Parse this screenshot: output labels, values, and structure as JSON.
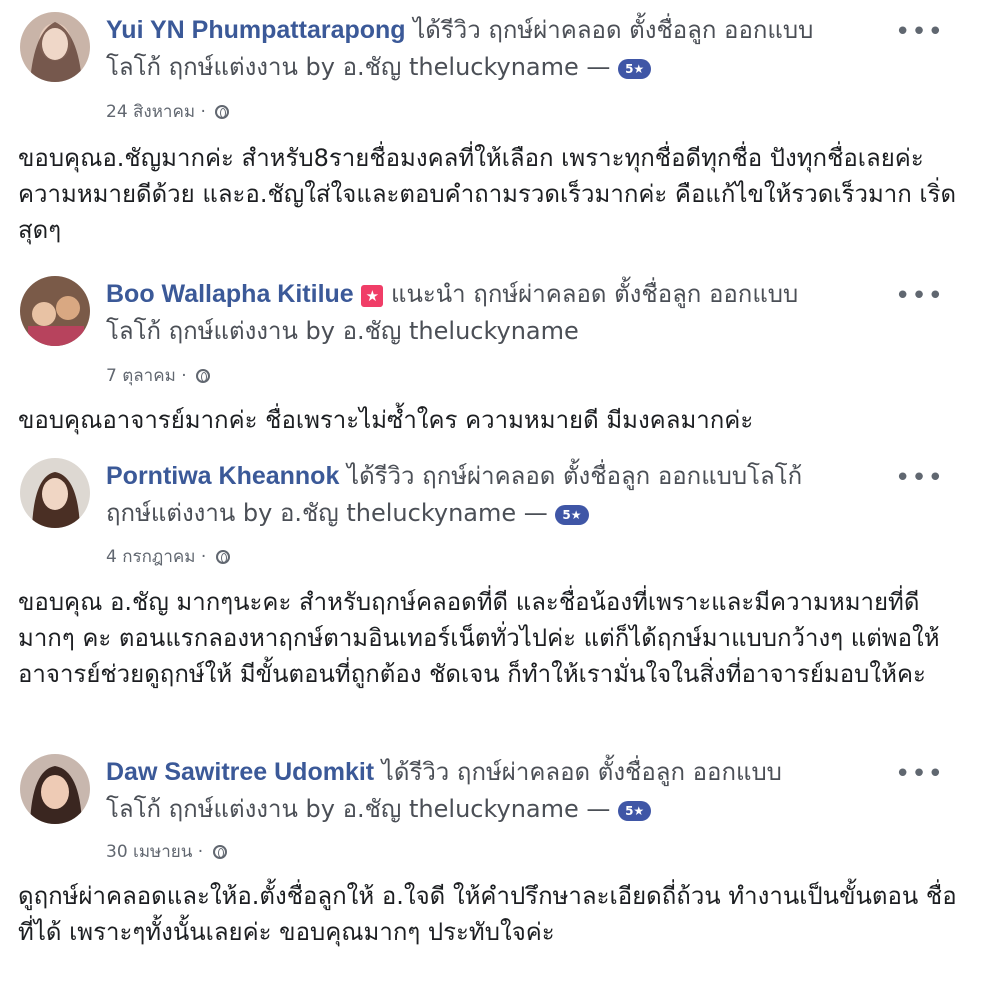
{
  "reviews": [
    {
      "name": "Yui YN Phumpattarapong",
      "verb": "ได้รีวิว",
      "page_line1": "ฤกษ์ผ่าคลอด ตั้งชื่อลูก ออกแบบ",
      "page_line2": "โลโก้ ฤกษ์แต่งงาน by อ.ชัญ theluckyname —",
      "rating": "5★",
      "date": "24 สิงหาคม ·",
      "body": "ขอบคุณอ.ชัญมากค่ะ สำหรับ8รายชื่อมงคลที่ให้เลือก เพราะทุกชื่อดีทุกชื่อ ปังทุกชื่อเลยค่ะ ความหมายดีด้วย และอ.ชัญใส่ใจและตอบคำถามรวดเร็วมากค่ะ คือแก้ไขให้รวดเร็วมาก เริ่ดสุดๆ",
      "more": "•••"
    },
    {
      "name": "Boo Wallapha Kitilue",
      "verb": "แนะนำ",
      "page_line1": "ฤกษ์ผ่าคลอด ตั้งชื่อลูก ออกแบบ",
      "page_line2": "โลโก้ ฤกษ์แต่งงาน by อ.ชัญ theluckyname",
      "rating": "",
      "date": "7 ตุลาคม ·",
      "body": "ขอบคุณอาจารย์มากค่ะ ชื่อเพราะไม่ซ้ำใคร ความหมายดี มีมงคลมากค่ะ",
      "more": "•••"
    },
    {
      "name": "Porntiwa Kheannok",
      "verb": "ได้รีวิว",
      "page_line1": "ฤกษ์ผ่าคลอด ตั้งชื่อลูก ออกแบบโลโก้",
      "page_line2": "ฤกษ์แต่งงาน by อ.ชัญ theluckyname —",
      "rating": "5★",
      "date": "4 กรกฎาคม ·",
      "body": "ขอบคุณ อ.ชัญ มากๆนะคะ สำหรับฤกษ์คลอดที่ดี และชื่อน้องที่เพราะและมีความหมายที่ดีมากๆ คะ ตอนแรกลองหาฤกษ์ตามอินเทอร์เน็ตทั่วไปค่ะ แต่ก็ได้ฤกษ์มาแบบกว้างๆ แต่พอให้อาจารย์ช่วยดูฤกษ์ให้ มีขั้นตอนที่ถูกต้อง ชัดเจน ก็ทำให้เรามั่นใจในสิ่งที่อาจารย์มอบให้คะ",
      "more": "•••"
    },
    {
      "name": "Daw Sawitree Udomkit",
      "verb": "ได้รีวิว",
      "page_line1": "ฤกษ์ผ่าคลอด ตั้งชื่อลูก ออกแบบ",
      "page_line2": "โลโก้ ฤกษ์แต่งงาน by อ.ชัญ theluckyname —",
      "rating": "5★",
      "date": "30 เมษายน ·",
      "body": "ดูฤกษ์ผ่าคลอดและให้อ.ตั้งชื่อลูกให้ อ.ใจดี ให้คำปรึกษาละเอียดถี่ถ้วน ทำงานเป็นขั้นตอน ชื่อที่ได้ เพราะๆทั้งนั้นเลยค่ะ ขอบคุณมากๆ ประทับใจค่ะ",
      "more": "•••"
    }
  ],
  "colors": {
    "name": "#3b5998",
    "badge": "#3f56a6",
    "recommend": "#f03d67"
  },
  "icons": {
    "globe": "globe-icon",
    "more": "more-options-icon",
    "recommend": "recommend-icon"
  }
}
